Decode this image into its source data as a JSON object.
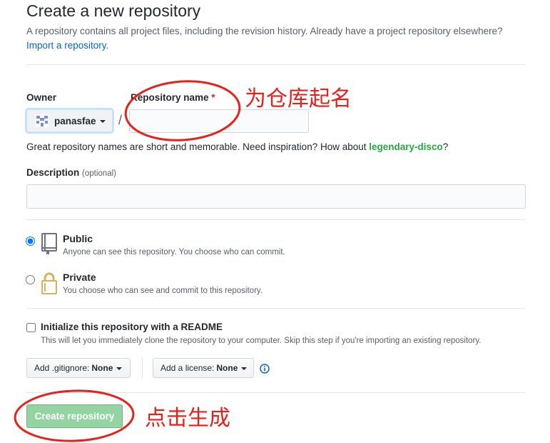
{
  "header": {
    "title": "Create a new repository",
    "subtitle": "A repository contains all project files, including the revision history. Already have a project repository elsewhere?",
    "import_link": "Import a repository."
  },
  "owner": {
    "label": "Owner",
    "value": "panasfae"
  },
  "separator": "/",
  "repo_name": {
    "label": "Repository name",
    "required_mark": "*",
    "value": "",
    "placeholder": ""
  },
  "hint": {
    "text": "Great repository names are short and memorable. Need inspiration? How about",
    "suggestion": "legendary-disco",
    "end": "?"
  },
  "description": {
    "label": "Description",
    "optional": "(optional)",
    "value": "",
    "placeholder": ""
  },
  "visibility": {
    "selected": "Public",
    "public": {
      "title": "Public",
      "desc": "Anyone can see this repository. You choose who can commit."
    },
    "private": {
      "title": "Private",
      "desc": "You choose who can see and commit to this repository."
    }
  },
  "readme": {
    "checked": false,
    "title": "Initialize this repository with a README",
    "desc": "This will let you immediately clone the repository to your computer. Skip this step if you're importing an existing repository."
  },
  "gitignore": {
    "label": "Add .gitignore:",
    "value": "None"
  },
  "license": {
    "label": "Add a license:",
    "value": "None"
  },
  "create_button": "Create repository",
  "annotations": {
    "name_note": "为仓库起名",
    "create_note": "点击生成",
    "color": "#e8201a"
  },
  "icons": [
    "identicon-avatar",
    "chevron-down-icon",
    "repo-book-icon",
    "lock-icon",
    "info-icon"
  ]
}
